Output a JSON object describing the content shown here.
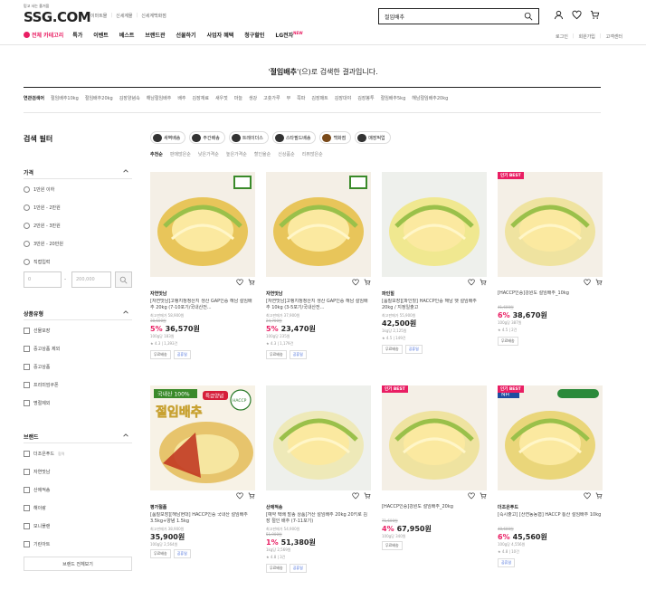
{
  "header": {
    "logo_sub": "믿고 사는 즐거움",
    "logo": "SSG.COM",
    "top_links": [
      "이마트몰",
      "신세계몰",
      "신세계백화점"
    ],
    "search_value": "절임배추",
    "gnb_category": "전체 카테고리",
    "gnb": [
      "특가",
      "이벤트",
      "베스트",
      "브랜드관",
      "선물하기",
      "사업자 혜택",
      "청구할인"
    ],
    "gnb_lg": "LG전자",
    "gnb_lg_badge": "NEW",
    "util": [
      "로그인",
      "회원가입",
      "고객센터"
    ]
  },
  "result": {
    "keyword": "절임배추",
    "text": "(으)로 검색한 결과입니다."
  },
  "related": {
    "label": "연관검색어",
    "terms": [
      "절임배추10kg",
      "절임배추20kg",
      "김장양념속",
      "해남절임배추",
      "배추",
      "김장재료",
      "새우젓",
      "마늘",
      "생강",
      "고춧가루",
      "무",
      "쪽파",
      "김장매트",
      "김장대야",
      "김장봉투",
      "절임배추5kg",
      "해남절임배추20kg"
    ]
  },
  "filters": {
    "title": "검색 필터",
    "price": {
      "title": "가격",
      "options": [
        "1만원 이하",
        "1만원 - 2만원",
        "2만원 - 3만원",
        "3만원 - 20만원",
        "직접입력"
      ],
      "min_placeholder": "0",
      "max_placeholder": "200,000"
    },
    "type": {
      "title": "상품유형",
      "options": [
        "선물포장",
        "중고상품 제외",
        "중고상품",
        "프리미엄쿠폰",
        "명절제외"
      ]
    },
    "brand": {
      "title": "브랜드",
      "options": [
        {
          "name": "더조은푸드",
          "sub": "협력"
        },
        {
          "name": "자연맛남",
          "sub": ""
        },
        {
          "name": "산애적송",
          "sub": ""
        },
        {
          "name": "해이랑",
          "sub": ""
        },
        {
          "name": "모니플랜",
          "sub": ""
        },
        {
          "name": "기린아트",
          "sub": ""
        }
      ],
      "all_button": "브랜드 전체보기"
    }
  },
  "chips": [
    "새벽배송",
    "주간배송",
    "트레이더스",
    "스타필드배송",
    "백화점",
    "매장픽업"
  ],
  "chip_icons": [
    "truck-icon",
    "truck-icon",
    "cart-icon",
    "store-icon",
    "bag-icon",
    "pickup-icon"
  ],
  "sorts": [
    "추천순",
    "판매많은순",
    "낮은가격순",
    "높은가격순",
    "할인율순",
    "신상품순",
    "리뷰많은순"
  ],
  "products": [
    {
      "brand": "자연맛남",
      "name": "[자연맛남]고랭지청정산지 생산 GAP인증 해남 절임배추 20kg (7-10포기/국내산전...",
      "orig_label": "최고판매가 58,900원",
      "orig": "38,600원",
      "pct": "5%",
      "price": "36,570원",
      "unit": "100g당 183원",
      "rating": "4.3",
      "reviews": "1,393건",
      "tags": [
        "무료배송",
        "공휴일"
      ],
      "badge": "",
      "color": "#e8c55a"
    },
    {
      "brand": "자연맛남",
      "name": "[자연맛남]고랭지청정산지 생산 GAP인증 해남 절임배추 10kg (3-5포기/국내산전...",
      "orig_label": "최고판매가 37,900원",
      "orig": "24,700원",
      "pct": "5%",
      "price": "23,470원",
      "unit": "100g당 235원",
      "rating": "4.3",
      "reviews": "1,179건",
      "tags": [
        "무료배송",
        "공휴일"
      ],
      "badge": "",
      "color": "#e8c55a"
    },
    {
      "brand": "파인힐",
      "name": "[품질보장][파인힐] HACCP인증 해남 햇 절임배추 20kg / 지정일출고",
      "orig_label": "최고판매가 55,900원",
      "orig": "",
      "pct": "",
      "price": "42,500원",
      "unit": "1kg당 2,125원",
      "rating": "4.5",
      "reviews": "149건",
      "tags": [
        "무료배송",
        "공휴일"
      ],
      "badge": "",
      "color": "#f0e890"
    },
    {
      "brand": "",
      "name": "[HACCP인증]강원도 절임배추_10kg",
      "orig_label": "",
      "orig": "41,600원",
      "pct": "6%",
      "price": "38,670원",
      "unit": "100g당 387원",
      "rating": "4.5",
      "reviews": "2건",
      "tags": [
        "무료배송"
      ],
      "badge": "인기 BEST",
      "color": "#efe3a0"
    },
    {
      "brand": "평가절품",
      "name": "[품질보장][해남현대] HACCP인증 국내산 절임배추 3.5kg+양념 1.5kg",
      "orig_label": "최고판매가 38,900원",
      "orig": "",
      "pct": "",
      "price": "35,900원",
      "unit": "100g당 2,564원",
      "rating": "",
      "reviews": "",
      "tags": [
        "무료배송",
        "공휴일"
      ],
      "badge": "",
      "color": "#e7c46c",
      "promo_top": "국내산 100%",
      "promo_tag": "특급양념",
      "promo_title": "절임배추",
      "promo_seal": "HACCP"
    },
    {
      "brand": "산애적송",
      "name": "[예약 택배 발송 상품]거산 절임배추 20kg 20키로 김장 절인 배추 (7-11포기)",
      "orig_label": "최고판매가 54,900원",
      "orig": "51,900원",
      "pct": "1%",
      "price": "51,380원",
      "unit": "1kg당 2,569원",
      "rating": "4.8",
      "reviews": "3건",
      "tags": [
        "무료배송",
        "공휴일"
      ],
      "badge": "",
      "color": "#eee9b8"
    },
    {
      "brand": "",
      "name": "[HACCP인증]강원도 절임배추_20kg",
      "orig_label": "",
      "orig": "71,600원",
      "pct": "4%",
      "price": "67,950원",
      "unit": "100g당 340원",
      "rating": "",
      "reviews": "",
      "tags": [
        "무료배송"
      ],
      "badge": "인기 BEST",
      "color": "#efe3a0"
    },
    {
      "brand": "더조은푸드",
      "name": "[즉시출고] [산연동농협] HACCP 통산 절임배추 10kg",
      "orig_label": "",
      "orig": "48,600원",
      "pct": "6%",
      "price": "45,560원",
      "unit": "100g당 4,556원",
      "rating": "4.8",
      "reviews": "10건",
      "tags": [
        "공휴일"
      ],
      "badge": "인기 BEST",
      "color": "#ead67a",
      "logo_text": "NH"
    }
  ]
}
